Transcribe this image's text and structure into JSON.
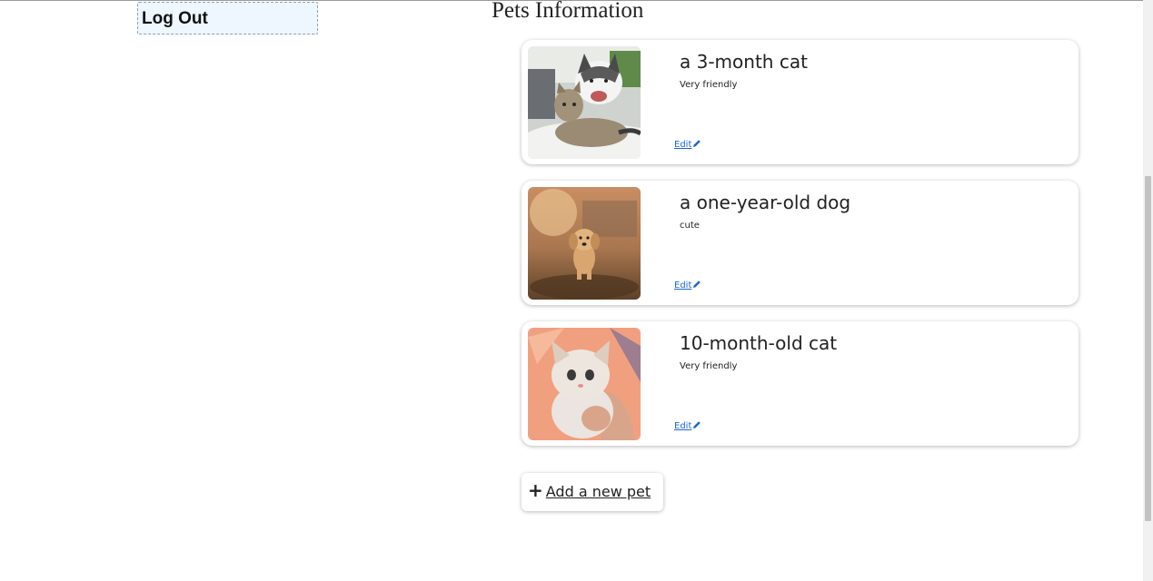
{
  "header": {
    "logout_label": "Log Out",
    "page_title": "Pets Information"
  },
  "pets": [
    {
      "name": "a 3-month cat",
      "description": "Very friendly",
      "edit_label": "Edit",
      "icon": "pencil-icon",
      "photo": "cat-and-husky-photo"
    },
    {
      "name": "a one-year-old dog",
      "description": "cute",
      "edit_label": "Edit",
      "icon": "pencil-icon",
      "photo": "puppy-running-photo"
    },
    {
      "name": "10-month-old cat",
      "description": "Very friendly",
      "edit_label": "Edit",
      "icon": "pencil-icon",
      "photo": "kitten-in-hands-photo"
    }
  ],
  "add_pet": {
    "icon": "plus-icon",
    "label": "Add a new pet"
  },
  "colors": {
    "link": "#1a66d6",
    "logout_bg": "#eef6ff"
  }
}
